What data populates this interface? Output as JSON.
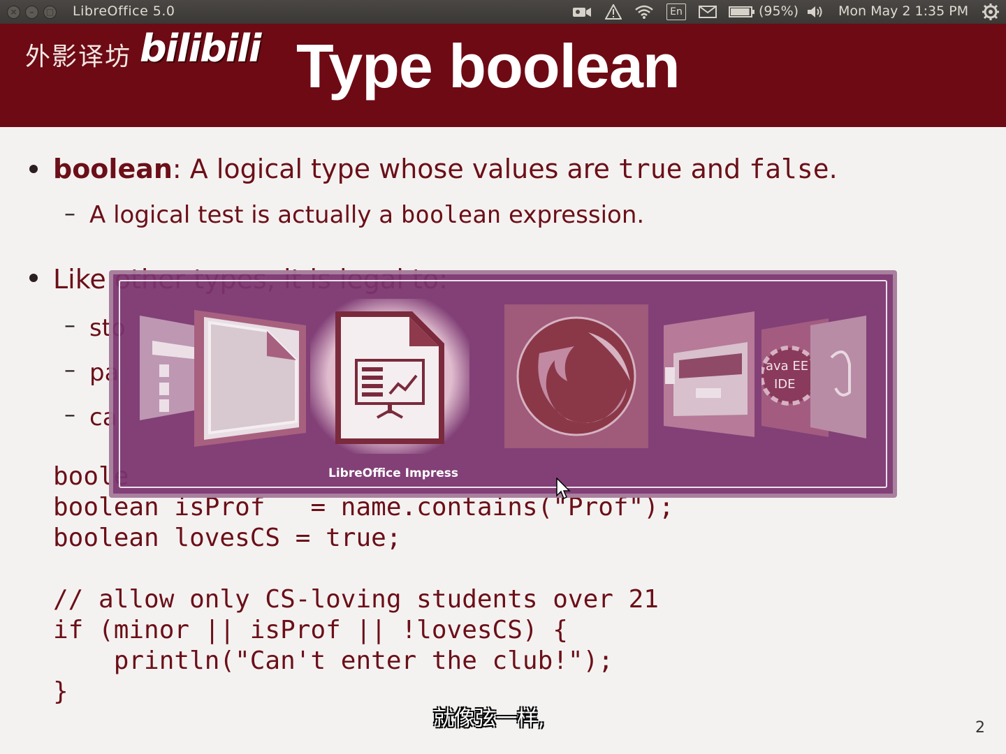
{
  "topbar": {
    "app_title": "LibreOffice 5.0",
    "window_buttons": [
      "close-icon",
      "minimize-icon",
      "maximize-icon"
    ],
    "tray_icons": [
      "camera-icon",
      "warning-icon",
      "wifi-icon",
      "keyboard-language-icon",
      "mail-icon",
      "battery-icon",
      "volume-icon",
      "power-icon"
    ],
    "language": "En",
    "battery_percent": "(95%)",
    "battery_level": 0.95,
    "clock": "Mon May 2  1:35 PM"
  },
  "watermark": {
    "chinese": "外影译坊",
    "logo": "bilibili"
  },
  "slide": {
    "title": "Type boolean",
    "bullet1": {
      "keyword": "boolean",
      "text_a": ": A logical type whose values are ",
      "code_true": "true",
      "text_b": " and ",
      "code_false": "false",
      "text_c": "."
    },
    "sub1": {
      "text_a": "A logical test is actually a ",
      "code": "boolean",
      "text_b": " expression."
    },
    "bullet2": {
      "visible": "Like",
      "hidden": "other types, it is legal to:"
    },
    "sub_items": [
      "sto",
      "pa",
      "ca"
    ],
    "code_lines": [
      "boole",
      "boolean isProf   = name.contains(\"Prof\");",
      "boolean lovesCS = true;",
      "",
      "// allow only CS-loving students over 21",
      "if (minor || isProf || !lovesCS) {",
      "    println(\"Can't enter the club!\");",
      "}"
    ],
    "page_number": "2"
  },
  "subtitle_text": "就像弦一样,",
  "switcher": {
    "selected_label": "LibreOffice Impress",
    "apps": [
      {
        "name": "Files",
        "icon": "files-icon"
      },
      {
        "name": "LibreOffice",
        "icon": "libreoffice-icon"
      },
      {
        "name": "LibreOffice Impress",
        "icon": "libreoffice-impress-icon",
        "selected": true
      },
      {
        "name": "Firefox",
        "icon": "firefox-icon"
      },
      {
        "name": "File Cabinet",
        "icon": "file-cabinet-icon"
      },
      {
        "name": "Java EE IDE",
        "icon": "java-ee-ide-icon",
        "label": "Java EE IDE"
      },
      {
        "name": "Other App",
        "icon": "app-icon"
      }
    ]
  },
  "colors": {
    "header": "#6e0a14",
    "text": "#6b0f18",
    "switcher_bg": "#7a346e"
  }
}
